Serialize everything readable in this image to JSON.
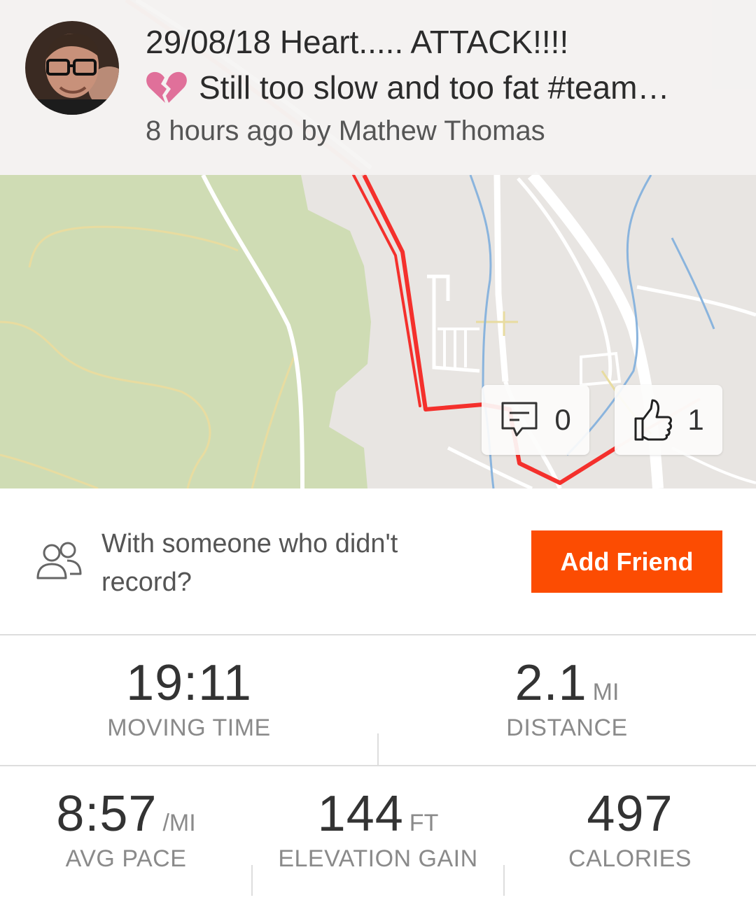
{
  "activity": {
    "title": "29/08/18 Heart..... ATTACK!!!!",
    "description": "Still too slow and too fat #team…",
    "meta": "8 hours ago by Mathew Thomas"
  },
  "social": {
    "comment_count": "0",
    "kudos_count": "1"
  },
  "add_friend": {
    "prompt": "With someone who didn't record?",
    "button_label": "Add Friend"
  },
  "stats": {
    "moving_time": {
      "value": "19:11",
      "label": "MOVING TIME"
    },
    "distance": {
      "value": "2.1",
      "unit": "MI",
      "label": "DISTANCE"
    },
    "avg_pace": {
      "value": "8:57",
      "unit": "/MI",
      "label": "AVG PACE"
    },
    "elevation_gain": {
      "value": "144",
      "unit": "FT",
      "label": "ELEVATION GAIN"
    },
    "calories": {
      "value": "497",
      "label": "CALORIES"
    }
  },
  "colors": {
    "accent": "#fc4c02",
    "route": "#f4302c",
    "map_park": "#cfdcb4",
    "map_land": "#e8e5e2"
  },
  "icons": {
    "avatar": "user-avatar",
    "heart": "broken-heart-icon",
    "comment": "comment-icon",
    "kudos": "thumbs-up-icon",
    "friends": "friends-icon"
  }
}
